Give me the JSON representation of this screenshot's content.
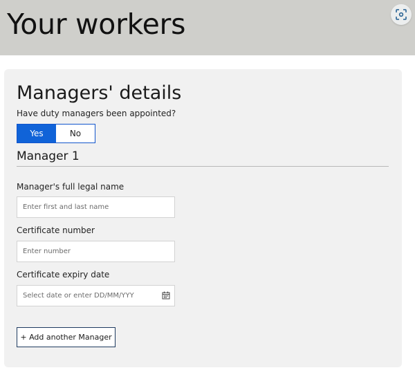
{
  "header": {
    "title": "Your workers",
    "scan_icon": "scan-icon"
  },
  "managers": {
    "title": "Managers' details",
    "question": "Have duty managers been appointed?",
    "toggle": {
      "yes_label": "Yes",
      "no_label": "No",
      "selected": "Yes"
    },
    "manager_title": "Manager 1",
    "fields": {
      "name": {
        "label": "Manager's full legal name",
        "placeholder": "Enter first and last name",
        "value": ""
      },
      "certificate": {
        "label": "Certificate number",
        "placeholder": "Enter number",
        "value": ""
      },
      "expiry": {
        "label": "Certificate expiry date",
        "placeholder": "Select date or enter DD/MM/YYY",
        "value": "",
        "icon": "calendar-icon"
      }
    },
    "add_button_label": "+ Add another Manager"
  },
  "colors": {
    "header_bg": "#cfcfcb",
    "card_bg": "#f1f1f1",
    "accent": "#1063d8",
    "button_border": "#1e3a5f"
  }
}
